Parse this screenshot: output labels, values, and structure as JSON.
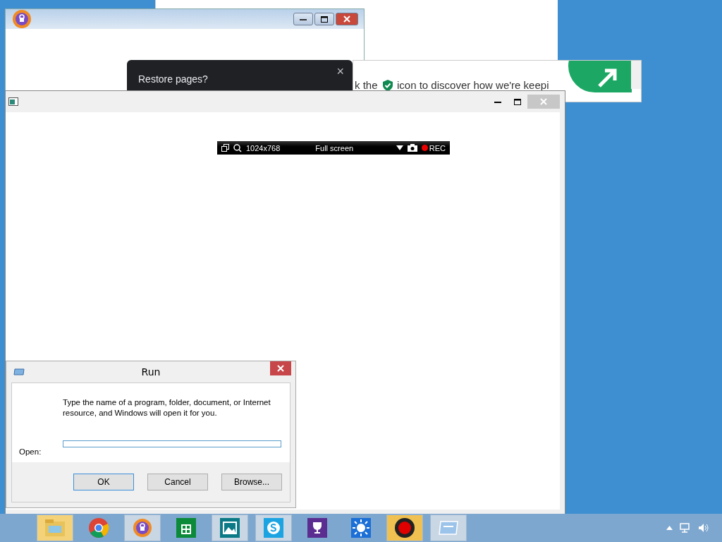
{
  "restore_popup": {
    "title": "Restore pages?",
    "close": "×"
  },
  "browser_strip": {
    "text_before": "k the",
    "text_after": "icon to discover how we're keepi"
  },
  "recorder_bar": {
    "resolution": "1024x768",
    "mode": "Full screen",
    "rec": "REC"
  },
  "run_dialog": {
    "title": "Run",
    "description": "Type the name of a program, folder, document, or Internet resource, and Windows will open it for you.",
    "open_label": "Open:",
    "buttons": [
      {
        "label": "OK",
        "default": true
      },
      {
        "label": "Cancel",
        "default": false
      },
      {
        "label": "Browse...",
        "default": false
      }
    ]
  },
  "taskbar": {
    "items": [
      {
        "kind": "folder",
        "running": true,
        "color": "#f3d27a"
      },
      {
        "kind": "chrome",
        "running": false
      },
      {
        "kind": "shield",
        "running": true,
        "color": "#c9d6e4"
      },
      {
        "kind": "store",
        "running": false
      },
      {
        "kind": "photos",
        "running": true,
        "color": "#c9d6e4"
      },
      {
        "kind": "skype",
        "running": true,
        "color": "#c9d6e4"
      },
      {
        "kind": "trophy",
        "running": false
      },
      {
        "kind": "weather",
        "running": false
      },
      {
        "kind": "record",
        "running": true,
        "color": "#f0c050"
      },
      {
        "kind": "run",
        "running": true,
        "color": "#c9d6e4"
      }
    ]
  }
}
